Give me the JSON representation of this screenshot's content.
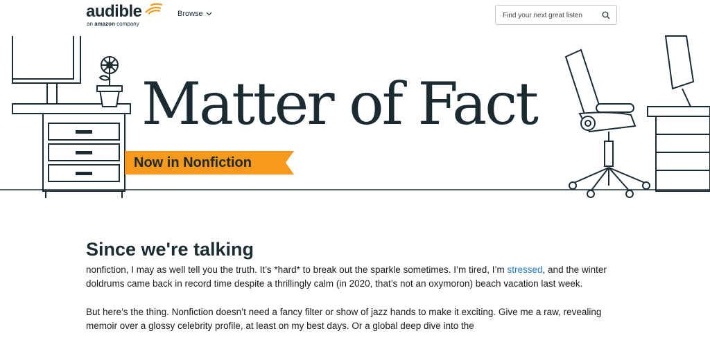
{
  "header": {
    "logo_word": "audible",
    "logo_sub_pre": "an ",
    "logo_sub_brand": "amazon",
    "logo_sub_post": " company",
    "browse_label": "Browse",
    "search_placeholder": "Find your next great listen",
    "accent_color": "#f7991c",
    "dark_color": "#1b2b32"
  },
  "hero": {
    "title": "Matter of Fact",
    "ribbon": "Now in Nonfiction",
    "ribbon_color": "#f7991c"
  },
  "article": {
    "heading": "Since we're talking",
    "p1_before": "nonfiction, I may as well tell you the truth. It’s *hard* to break out the sparkle sometimes. I’m tired, I’m ",
    "p1_link": "stressed",
    "p1_after": ", and the winter doldrums came back in record time despite a thrillingly calm (in 2020, that’s not an oxymoron) beach vacation last week.",
    "p2": "But here’s the thing. Nonfiction doesn’t need a fancy filter or show of jazz hands to make it exciting. Give me a raw, revealing memoir over a glossy celebrity profile, at least on my best days. Or a global deep dive into the",
    "link_color": "#1f7ac2"
  }
}
